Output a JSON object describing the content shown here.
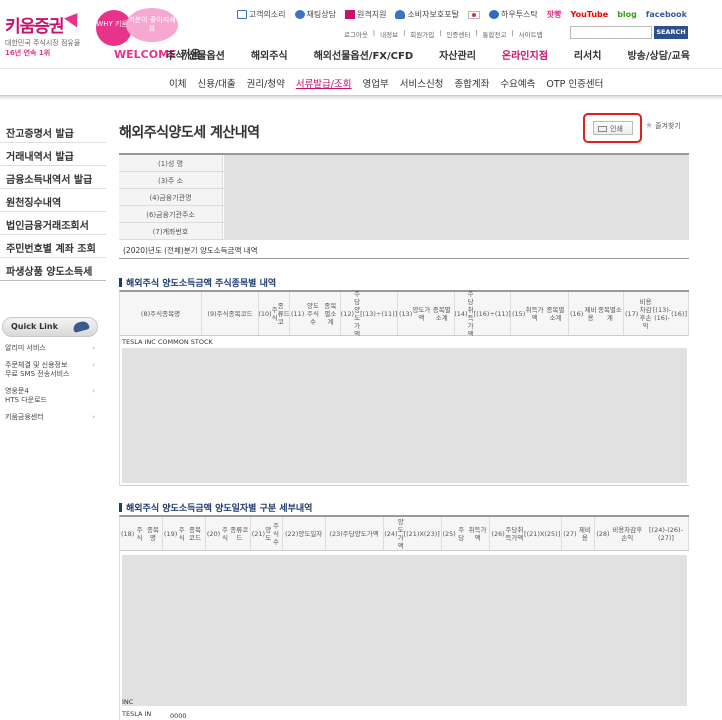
{
  "brand": {
    "name": "키움증권",
    "sub1": "대한민국 주식시장 점유율",
    "sub2": "16년 연속 1위",
    "bubble1": "WHY 키움?",
    "bubble2": "기분이 좋아지세요",
    "welcome": "WELCOME",
    "welcome_suffix": "키움"
  },
  "top_links": [
    "고객의소리",
    "채팅상담",
    "원격지원",
    "소비자보호포탈",
    "하우투스탁",
    "팟빵",
    "YouTube",
    "blog",
    "facebook"
  ],
  "sub_links": [
    "로그아웃",
    "|",
    "내정보",
    "|",
    "회원가입",
    "|",
    "인증센터",
    "|",
    "통합전고",
    "|",
    "사이트맵"
  ],
  "search": {
    "button": "SEARCH",
    "placeholder": ""
  },
  "gnb": [
    "주식/선물옵션",
    "해외주식",
    "해외선물옵션/FX/CFD",
    "자산관리",
    "온라인지점",
    "리서치",
    "방송/상담/교육"
  ],
  "gnb_active_index": 4,
  "lnb": [
    "이체",
    "신용/대출",
    "권리/청약",
    "서류발급/조회",
    "영업부",
    "서비스신청",
    "종합계좌",
    "수요예측",
    "OTP 인증센터"
  ],
  "lnb_active_index": 3,
  "sidebar": [
    "잔고증명서 발급",
    "거래내역서 발급",
    "금융소득내역서 발급",
    "원천징수내역",
    "법인금융거래조회서",
    "주민번호별 계좌 조회",
    "파생상품 양도소득세"
  ],
  "quick_link": {
    "title": "Quick Link",
    "items": [
      [
        "알리미 서비스"
      ],
      [
        "주문체결 및 신용정보",
        "무료 SMS 전송서비스"
      ],
      [
        "영웅문4",
        "HTS 다운로드"
      ],
      [
        "키움금융센터"
      ]
    ]
  },
  "page": {
    "title": "해외주식양도세 계산내역",
    "print": "인쇄",
    "favorite": "즐겨찾기"
  },
  "info_labels": [
    "(1)성 명",
    "(3)주 소",
    "(4)금융기관명",
    "(6)금융기관주소",
    "(7)계좌번호"
  ],
  "info_note": "(2020)년도 (전체)분기 양도소득금액 내역",
  "section1": {
    "title": "해외주식 양도소득금액 주식종목별 내역",
    "headers": [
      [
        "(8)",
        "주식",
        "종목명"
      ],
      [
        "(9)",
        "주식",
        "종목코드"
      ],
      [
        "(10)",
        "주식",
        "종류코",
        "드"
      ],
      [
        "(11)",
        "양도주식수",
        "종목별소계"
      ],
      [
        "(12)",
        "주당양도가액",
        "[(13)÷(11)]"
      ],
      [
        "(13)",
        "양도가액",
        "종목별소계"
      ],
      [
        "(14)",
        "주당취득가액",
        "[(16)÷(11)]"
      ],
      [
        "(15)",
        "취득가액",
        "종목별소계"
      ],
      [
        "(16)",
        "제비용",
        "종목별소계"
      ],
      [
        "(17)",
        "비용차감후손익",
        "[(13)-(16)-",
        "(16)]"
      ]
    ],
    "first_row_label": "TESLA INC COMMON STOCK"
  },
  "section2": {
    "title": "해외주식 양도소득금액 양도일자별 구분 세부내역",
    "headers": [
      [
        "(18)",
        "주식",
        "종목명"
      ],
      [
        "(19)",
        "주식",
        "종목코드"
      ],
      [
        "(20)",
        "주식",
        "종류코드"
      ],
      [
        "(21)",
        "양도",
        "주식수"
      ],
      [
        "(22)",
        "양도일자"
      ],
      [
        "(23)",
        "주당",
        "양도가액"
      ],
      [
        "(24)",
        "양도가액",
        "[(21)X(23)]"
      ],
      [
        "(25)",
        "주당",
        "취득가액"
      ],
      [
        "(26)",
        "주당취득가액",
        "[(21)X(25)]"
      ],
      [
        "(27)",
        "제비용"
      ],
      [
        "(28)",
        "비용차감후손익",
        "[(24)-(26)-(27)]"
      ]
    ],
    "row_label_top": "INC",
    "row_label_bottom": "TESLA IN",
    "row_label_bottom_value": "0000"
  }
}
